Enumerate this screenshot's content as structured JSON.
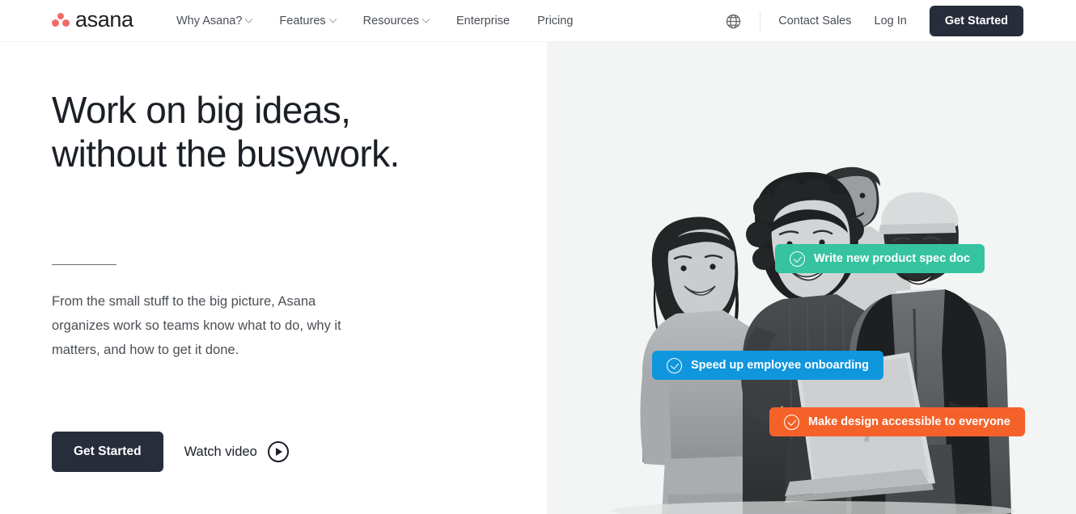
{
  "brand": {
    "name": "asana",
    "logo_dot_color": "#f06a6a",
    "dark": "#272d3b"
  },
  "nav": {
    "links": [
      {
        "label": "Why Asana?",
        "has_dropdown": true
      },
      {
        "label": "Features",
        "has_dropdown": true
      },
      {
        "label": "Resources",
        "has_dropdown": true
      },
      {
        "label": "Enterprise",
        "has_dropdown": false
      },
      {
        "label": "Pricing",
        "has_dropdown": false
      }
    ],
    "language_icon": "globe-icon",
    "contact_sales": "Contact Sales",
    "log_in": "Log In",
    "get_started": "Get Started"
  },
  "hero": {
    "headline_line1": "Work on big ideas,",
    "headline_line2": "without the busywork.",
    "subtext": "From the small stuff to the big picture, Asana organizes work so teams know what to do, why it matters, and how to get it done.",
    "primary_cta": "Get Started",
    "secondary_cta": "Watch video",
    "secondary_icon": "play-circle-icon",
    "background": "#f3f4f4",
    "pills": [
      {
        "label": "Write new product spec doc",
        "color": "#36c3a0",
        "icon": "check-circle-icon"
      },
      {
        "label": "Speed up employee onboarding",
        "color": "#0f96dd",
        "icon": "check-circle-icon"
      },
      {
        "label": "Make design accessible to everyone",
        "color": "#f4622a",
        "icon": "check-circle-icon"
      }
    ]
  }
}
